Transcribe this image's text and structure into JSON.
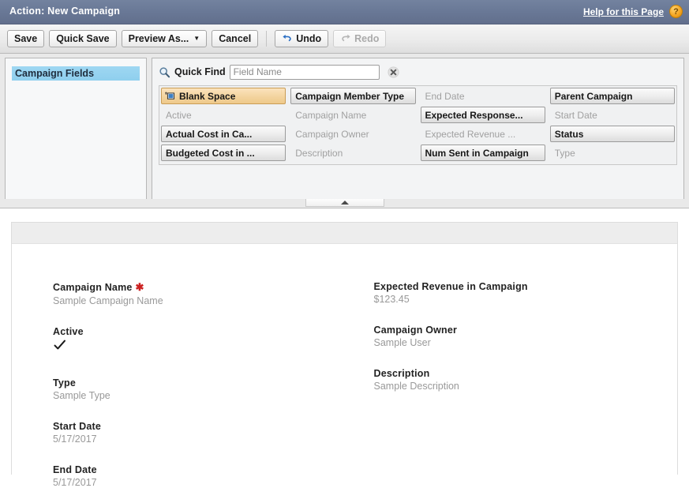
{
  "titlebar": {
    "title": "Action: New Campaign",
    "help_link": "Help for this Page",
    "help_badge": "?"
  },
  "toolbar": {
    "save_label": "Save",
    "quick_save_label": "Quick Save",
    "preview_as_label": "Preview As...",
    "preview_caret": "▼",
    "cancel_label": "Cancel",
    "undo_label": "Undo",
    "redo_label": "Redo"
  },
  "palette": {
    "sections": [
      {
        "label": "Campaign Fields",
        "selected": true
      }
    ],
    "quick_find": {
      "label": "Quick Find",
      "placeholder": "Field Name",
      "value": "",
      "search_icon": "search-icon",
      "clear_icon": "clear-icon"
    },
    "fields": [
      {
        "label": "Blank Space",
        "state": "blank"
      },
      {
        "label": "Campaign Member Type",
        "state": "available"
      },
      {
        "label": "End Date",
        "state": "used"
      },
      {
        "label": "Parent Campaign",
        "state": "available"
      },
      {
        "label": "Active",
        "state": "used"
      },
      {
        "label": "Campaign Name",
        "state": "used"
      },
      {
        "label": "Expected Response...",
        "state": "available"
      },
      {
        "label": "Start Date",
        "state": "used"
      },
      {
        "label": "Actual Cost in Ca...",
        "state": "available"
      },
      {
        "label": "Campaign Owner",
        "state": "used"
      },
      {
        "label": "Expected Revenue ...",
        "state": "used"
      },
      {
        "label": "Status",
        "state": "available"
      },
      {
        "label": "Budgeted Cost in ...",
        "state": "available"
      },
      {
        "label": "Description",
        "state": "used"
      },
      {
        "label": "Num Sent in Campaign",
        "state": "available"
      },
      {
        "label": "Type",
        "state": "used"
      }
    ],
    "collapse_handle": "collapse-palette-handle"
  },
  "preview": {
    "left_column": [
      {
        "label": "Campaign Name",
        "required": true,
        "value": "Sample Campaign Name",
        "type": "text"
      },
      {
        "label": "Active",
        "required": false,
        "value": "✓",
        "type": "checkbox"
      },
      {
        "label": "Type",
        "required": false,
        "value": "Sample Type",
        "type": "text"
      },
      {
        "label": "Start Date",
        "required": false,
        "value": "5/17/2017",
        "type": "text"
      },
      {
        "label": "End Date",
        "required": false,
        "value": "5/17/2017",
        "type": "text"
      }
    ],
    "right_column": [
      {
        "label": "Expected Revenue in Campaign",
        "required": false,
        "value": "$123.45",
        "type": "text"
      },
      {
        "label": "Campaign Owner",
        "required": false,
        "value": "Sample User",
        "type": "text"
      },
      {
        "label": "Description",
        "required": false,
        "value": "Sample Description",
        "type": "text"
      }
    ]
  },
  "colors": {
    "titlebar": "#697896",
    "section_selected": "#9ed7f2",
    "blank_space_chip": "#f3d49f",
    "required_star": "#cc2222",
    "help_badge": "#f5a623"
  }
}
